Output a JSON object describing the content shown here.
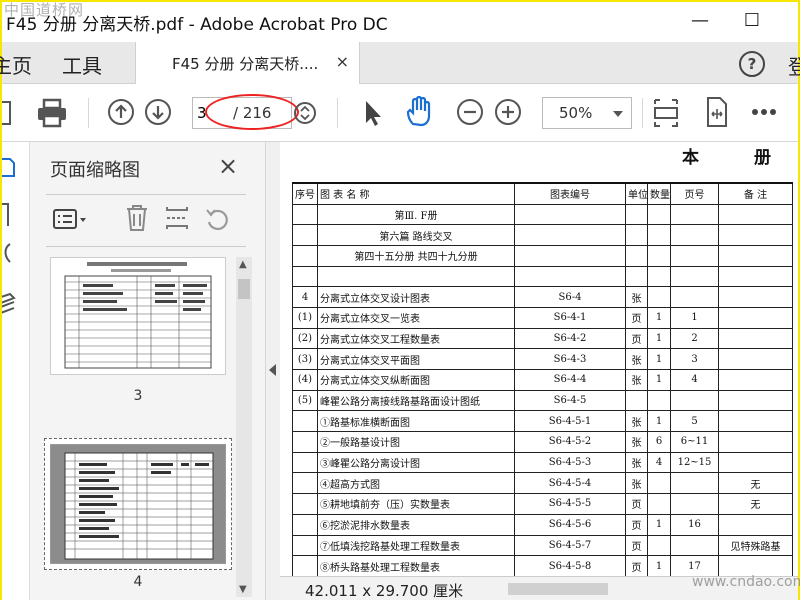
{
  "window": {
    "title": "F45 分册 分离天桥.pdf - Adobe Acrobat Pro DC",
    "watermark_top": "中国道桥网",
    "minimize": "—",
    "maximize": "☐"
  },
  "menu": {
    "home_label": "主页",
    "tools_label": "工具",
    "signin_label": "登"
  },
  "doc_tab": {
    "label": "F45 分册 分离天桥....",
    "close": "×"
  },
  "help_label": "?",
  "toolbar": {
    "page_current": "3",
    "page_total": "/ 216",
    "zoom": "50%"
  },
  "sidepanel": {
    "title": "页面缩略图",
    "close": "×",
    "thumbnails": [
      {
        "page": "3"
      },
      {
        "page": "4"
      }
    ]
  },
  "document": {
    "header_left": "本",
    "header_right": "册",
    "columns": [
      "序号",
      "图  表  名  称",
      "图表编号",
      "单位",
      "数量",
      "页号",
      "备  注"
    ],
    "rows": [
      {
        "no": "",
        "name": "第Ⅲ. F册",
        "code": "",
        "unit": "",
        "qty": "",
        "page": "",
        "note": "",
        "style": "center"
      },
      {
        "no": "",
        "name": "第六篇  路线交叉",
        "code": "",
        "unit": "",
        "qty": "",
        "page": "",
        "note": "",
        "style": "center"
      },
      {
        "no": "",
        "name": "第四十五分册  共四十九分册",
        "code": "",
        "unit": "",
        "qty": "",
        "page": "",
        "note": "",
        "style": "center"
      },
      {
        "no": "",
        "name": "",
        "code": "",
        "unit": "",
        "qty": "",
        "page": "",
        "note": "",
        "style": ""
      },
      {
        "no": "4",
        "name": "分离式立体交叉设计图表",
        "code": "S6-4",
        "unit": "张",
        "qty": "",
        "page": "",
        "note": "",
        "style": ""
      },
      {
        "no": "(1)",
        "name": "分离式立体交叉一览表",
        "code": "S6-4-1",
        "unit": "页",
        "qty": "1",
        "page": "1",
        "note": "",
        "style": ""
      },
      {
        "no": "(2)",
        "name": "分离式立体交叉工程数量表",
        "code": "S6-4-2",
        "unit": "页",
        "qty": "1",
        "page": "2",
        "note": "",
        "style": ""
      },
      {
        "no": "(3)",
        "name": "分离式立体交叉平面图",
        "code": "S6-4-3",
        "unit": "张",
        "qty": "1",
        "page": "3",
        "note": "",
        "style": ""
      },
      {
        "no": "(4)",
        "name": "分离式立体交叉纵断面图",
        "code": "S6-4-4",
        "unit": "张",
        "qty": "1",
        "page": "4",
        "note": "",
        "style": ""
      },
      {
        "no": "(5)",
        "name": "峰瞿公路分离接线路基路面设计图纸",
        "code": "S6-4-5",
        "unit": "",
        "qty": "",
        "page": "",
        "note": "",
        "style": ""
      },
      {
        "no": "",
        "name": "①路基标准横断面图",
        "code": "S6-4-5-1",
        "unit": "张",
        "qty": "1",
        "page": "5",
        "note": "",
        "style": ""
      },
      {
        "no": "",
        "name": "②一般路基设计图",
        "code": "S6-4-5-2",
        "unit": "张",
        "qty": "6",
        "page": "6~11",
        "note": "",
        "style": ""
      },
      {
        "no": "",
        "name": "③峰瞿公路分离设计图",
        "code": "S6-4-5-3",
        "unit": "张",
        "qty": "4",
        "page": "12~15",
        "note": "",
        "style": ""
      },
      {
        "no": "",
        "name": "④超高方式图",
        "code": "S6-4-5-4",
        "unit": "张",
        "qty": "",
        "page": "",
        "note": "无",
        "style": ""
      },
      {
        "no": "",
        "name": "⑤耕地填前夯（压）实数量表",
        "code": "S6-4-5-5",
        "unit": "页",
        "qty": "",
        "page": "",
        "note": "无",
        "style": ""
      },
      {
        "no": "",
        "name": "⑥挖淤泥排水数量表",
        "code": "S6-4-5-6",
        "unit": "页",
        "qty": "1",
        "page": "16",
        "note": "",
        "style": ""
      },
      {
        "no": "",
        "name": "⑦低填浅挖路基处理工程数量表",
        "code": "S6-4-5-7",
        "unit": "页",
        "qty": "",
        "page": "",
        "note": "见特殊路基",
        "style": ""
      },
      {
        "no": "",
        "name": "⑧桥头路基处理工程数量表",
        "code": "S6-4-5-8",
        "unit": "页",
        "qty": "1",
        "page": "17",
        "note": "",
        "style": ""
      }
    ]
  },
  "status": {
    "page_size": "42.011 x 29.700 厘米"
  },
  "watermark_bottom": "www.cndao.com",
  "colors": {
    "annotation": "#e22222",
    "accent_hand": "#1a6fd1",
    "border": "#f7e600"
  }
}
